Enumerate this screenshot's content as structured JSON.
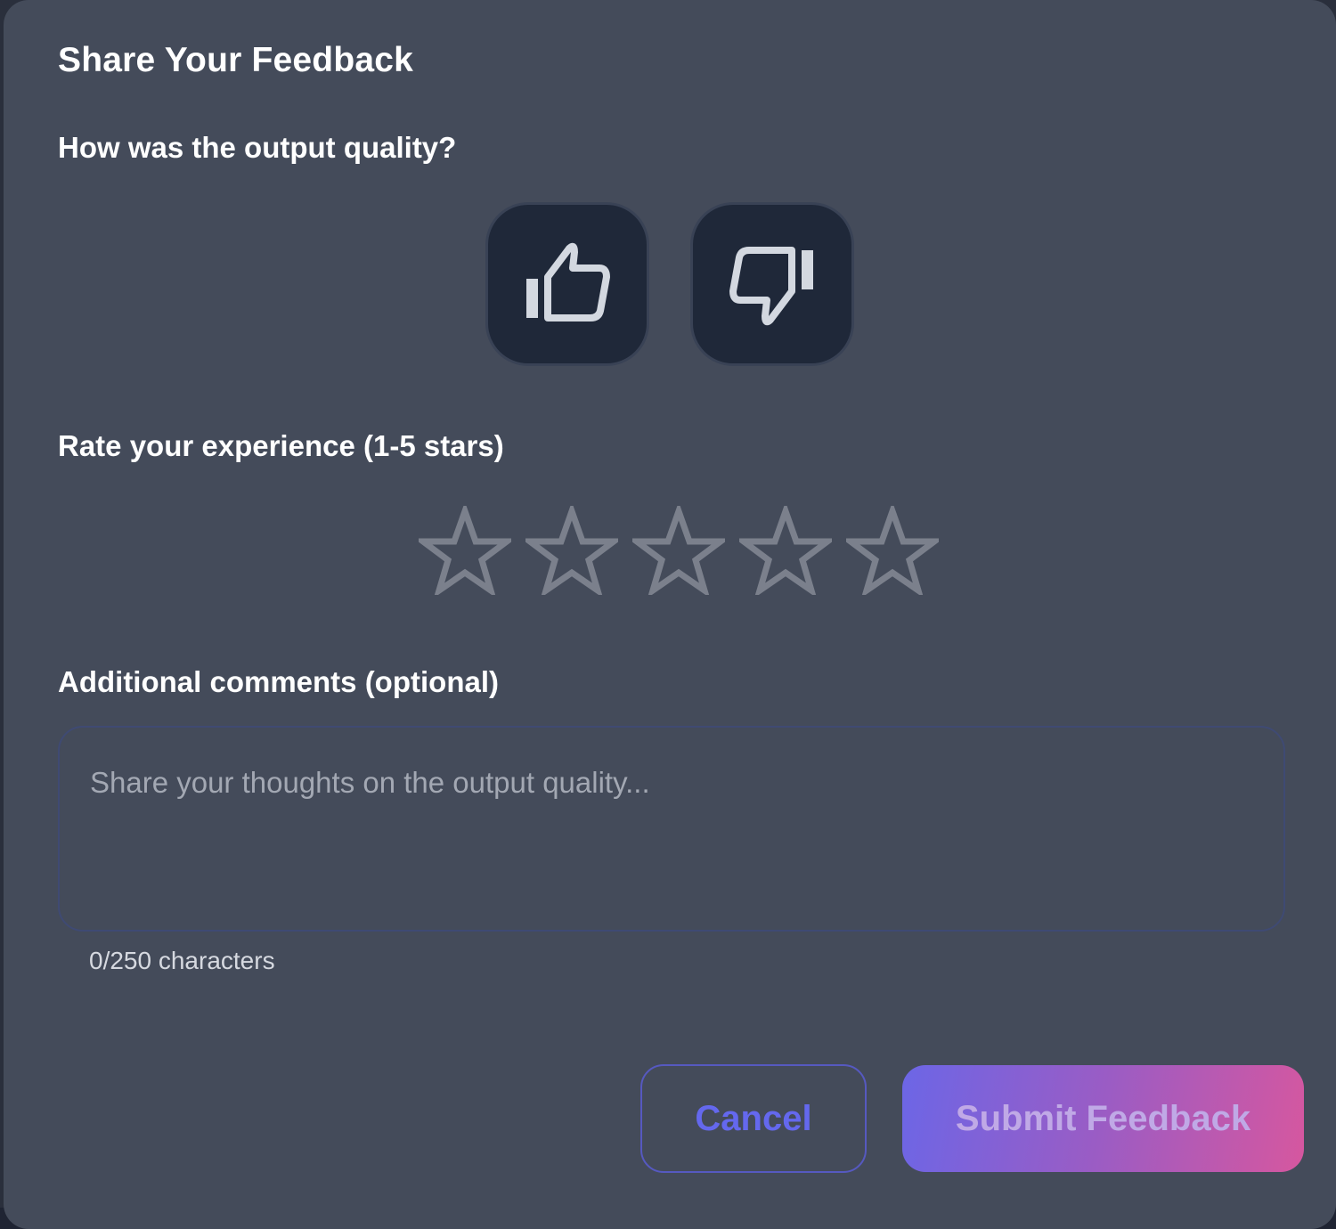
{
  "dialog": {
    "title": "Share Your Feedback"
  },
  "quality": {
    "question": "How was the output quality?",
    "thumbs_up_icon": "thumbs-up-icon",
    "thumbs_down_icon": "thumbs-down-icon"
  },
  "rating": {
    "label": "Rate your experience (1-5 stars)",
    "max_stars": 5,
    "selected_stars": 0,
    "star_color": "#7b808c"
  },
  "comments": {
    "label": "Additional comments (optional)",
    "placeholder": "Share your thoughts on the output quality...",
    "value": "",
    "char_count": "0/250 characters"
  },
  "actions": {
    "cancel_label": "Cancel",
    "submit_label": "Submit Feedback"
  },
  "colors": {
    "modal_bg": "#444b5a",
    "accent": "#6468ee",
    "submit_gradient_start": "#6c66e6",
    "submit_gradient_end": "#d6579f"
  }
}
